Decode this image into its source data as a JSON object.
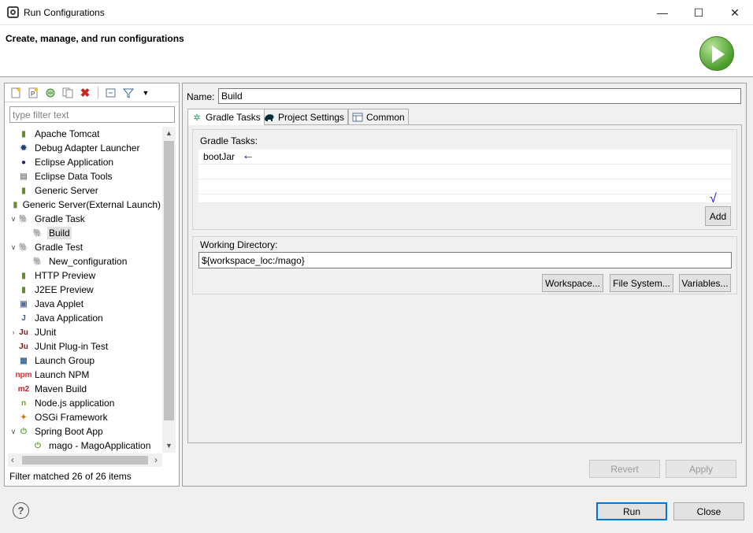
{
  "window": {
    "title": "Run Configurations",
    "minimize": "—",
    "maximize": "☐",
    "close": "✕"
  },
  "header": {
    "title": "Create, manage, and run configurations"
  },
  "left": {
    "filter_placeholder": "type filter text",
    "tree": [
      {
        "label": "Apache Tomcat",
        "icon": "server-icon",
        "glyph": "▮",
        "color": "#6a8a3a",
        "indent": 0,
        "twisty": ""
      },
      {
        "label": "Debug Adapter Launcher",
        "icon": "bug-icon",
        "glyph": "✹",
        "color": "#1d3f7a",
        "indent": 0,
        "twisty": ""
      },
      {
        "label": "Eclipse Application",
        "icon": "eclipse-icon",
        "glyph": "●",
        "color": "#2c2255",
        "indent": 0,
        "twisty": ""
      },
      {
        "label": "Eclipse Data Tools",
        "icon": "database-icon",
        "glyph": "▤",
        "color": "#888",
        "indent": 0,
        "twisty": ""
      },
      {
        "label": "Generic Server",
        "icon": "server-icon",
        "glyph": "▮",
        "color": "#6a8a3a",
        "indent": 0,
        "twisty": ""
      },
      {
        "label": "Generic Server(External Launch)",
        "icon": "server-icon",
        "glyph": "▮",
        "color": "#6a8a3a",
        "indent": 0,
        "twisty": ""
      },
      {
        "label": "Gradle Task",
        "icon": "gradle-elephant-icon",
        "glyph": "🐘",
        "color": "#02303a",
        "indent": 0,
        "twisty": "∨"
      },
      {
        "label": "Build",
        "icon": "gradle-elephant-icon",
        "glyph": "🐘",
        "color": "#02303a",
        "indent": 1,
        "twisty": "",
        "selected": true
      },
      {
        "label": "Gradle Test",
        "icon": "gradle-elephant-icon",
        "glyph": "🐘",
        "color": "#1ba1c6",
        "indent": 0,
        "twisty": "∨"
      },
      {
        "label": "New_configuration",
        "icon": "gradle-elephant-icon",
        "glyph": "🐘",
        "color": "#1ba1c6",
        "indent": 1,
        "twisty": ""
      },
      {
        "label": "HTTP Preview",
        "icon": "server-icon",
        "glyph": "▮",
        "color": "#6a8a3a",
        "indent": 0,
        "twisty": ""
      },
      {
        "label": "J2EE Preview",
        "icon": "server-icon",
        "glyph": "▮",
        "color": "#6a8a3a",
        "indent": 0,
        "twisty": ""
      },
      {
        "label": "Java Applet",
        "icon": "applet-icon",
        "glyph": "▣",
        "color": "#5a6e9a",
        "indent": 0,
        "twisty": ""
      },
      {
        "label": "Java Application",
        "icon": "java-app-icon",
        "glyph": "J",
        "color": "#3a5a9a",
        "indent": 0,
        "twisty": ""
      },
      {
        "label": "JUnit",
        "icon": "junit-icon",
        "glyph": "Ju",
        "color": "#7a2020",
        "indent": 0,
        "twisty": "›"
      },
      {
        "label": "JUnit Plug-in Test",
        "icon": "junit-icon",
        "glyph": "Ju",
        "color": "#7a2020",
        "indent": 0,
        "twisty": ""
      },
      {
        "label": "Launch Group",
        "icon": "launch-group-icon",
        "glyph": "▦",
        "color": "#3a6a9a",
        "indent": 0,
        "twisty": ""
      },
      {
        "label": "Launch NPM",
        "icon": "npm-icon",
        "glyph": "npm",
        "color": "#cb3837",
        "indent": 0,
        "twisty": ""
      },
      {
        "label": "Maven Build",
        "icon": "maven-icon",
        "glyph": "m2",
        "color": "#c0272d",
        "indent": 0,
        "twisty": ""
      },
      {
        "label": "Node.js application",
        "icon": "nodejs-icon",
        "glyph": "n",
        "color": "#6aa320",
        "indent": 0,
        "twisty": ""
      },
      {
        "label": "OSGi Framework",
        "icon": "osgi-icon",
        "glyph": "✦",
        "color": "#c87a2a",
        "indent": 0,
        "twisty": ""
      },
      {
        "label": "Spring Boot App",
        "icon": "spring-boot-icon",
        "glyph": "⏻",
        "color": "#5aa02c",
        "indent": 0,
        "twisty": "∨"
      },
      {
        "label": "mago - MagoApplication",
        "icon": "spring-boot-icon",
        "glyph": "⏻",
        "color": "#5aa02c",
        "indent": 1,
        "twisty": ""
      }
    ],
    "filter_status": "Filter matched 26 of 26 items"
  },
  "right": {
    "name_label": "Name:",
    "name_value": "Build",
    "tabs": [
      {
        "label": "Gradle Tasks",
        "icon": "gear-icon",
        "glyph": "✲",
        "color": "#2aa06a"
      },
      {
        "label": "Project Settings",
        "icon": "gradle-elephant-icon",
        "glyph": "🐘",
        "color": "#02303a"
      },
      {
        "label": "Common",
        "icon": "table-icon",
        "glyph": "▤",
        "color": "#5a6e9a"
      }
    ],
    "gradle_tasks_label": "Gradle Tasks:",
    "tasks": [
      "bootJar",
      "",
      "",
      ""
    ],
    "add_label": "Add",
    "working_dir_label": "Working Directory:",
    "working_dir_value": "${workspace_loc:/mago}",
    "workspace_label": "Workspace...",
    "file_system_label": "File System...",
    "variables_label": "Variables...",
    "revert_label": "Revert",
    "apply_label": "Apply"
  },
  "footer": {
    "help_glyph": "?",
    "run_label": "Run",
    "close_label": "Close"
  },
  "annotations": {
    "arrow": "←",
    "check": "√"
  }
}
